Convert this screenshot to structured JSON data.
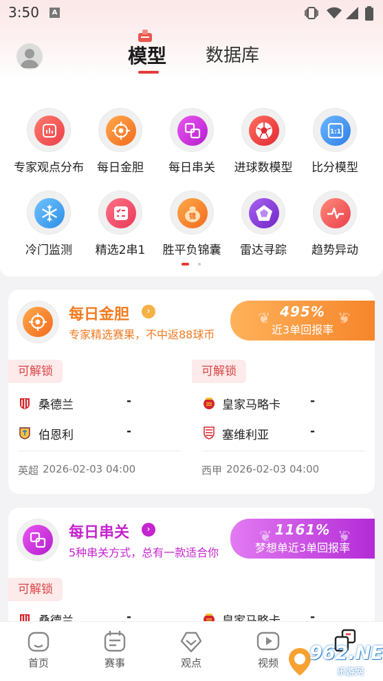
{
  "status_bar": {
    "time": "3:50",
    "notif_icon": "A"
  },
  "header": {
    "tabs": [
      {
        "label": "模型",
        "active": true
      },
      {
        "label": "数据库",
        "active": false
      }
    ],
    "accent": "#e63a3a"
  },
  "grid": [
    {
      "label": "专家观点分布",
      "icon": "bar-chart-icon",
      "color": "#ef5a5a"
    },
    {
      "label": "每日金胆",
      "icon": "target-icon",
      "color": "#f7892e"
    },
    {
      "label": "每日串关",
      "icon": "linked-squares-icon",
      "color": "#d12fd8"
    },
    {
      "label": "进球数模型",
      "icon": "soccer-ball-icon",
      "color": "#ee3b3b"
    },
    {
      "label": "比分模型",
      "icon": "scoreboard-icon",
      "color": "#3b8ff0"
    },
    {
      "label": "冷门监测",
      "icon": "snowflake-icon",
      "color": "#3aa5f2"
    },
    {
      "label": "精选2串1",
      "icon": "checklist-icon",
      "color": "#f04f66"
    },
    {
      "label": "胜平负锦囊",
      "icon": "money-bag-icon",
      "color": "#f7892e"
    },
    {
      "label": "雷达寻踪",
      "icon": "radar-pentagon-icon",
      "color": "#8b3fd8"
    },
    {
      "label": "趋势异动",
      "icon": "trend-pulse-icon",
      "color": "#ef4a4a"
    }
  ],
  "pager": {
    "pages": 2,
    "current": 1
  },
  "cards": [
    {
      "title": "每日金胆",
      "subtitle": "专家精选赛果，不中返88球币",
      "accent": "#f7892e",
      "return_value": "495%",
      "return_label": "近3单回报率",
      "matches": [
        {
          "unlock": "可解锁",
          "home": "桑德兰",
          "away": "伯恩利",
          "home_score": "-",
          "away_score": "-",
          "league": "英超",
          "time": "2026-02-03 04:00"
        },
        {
          "unlock": "可解锁",
          "home": "皇家马略卡",
          "away": "塞维利亚",
          "home_score": "-",
          "away_score": "-",
          "league": "西甲",
          "time": "2026-02-03 04:00"
        }
      ]
    },
    {
      "title": "每日串关",
      "subtitle": "5种串关方式，总有一款适合你",
      "accent": "#d12fd8",
      "return_value": "1161%",
      "return_label": "梦想单近3单回报率",
      "matches": [
        {
          "unlock": "可解锁",
          "home": "桑德兰",
          "home_score": "-"
        },
        {
          "unlock": "",
          "home": "皇家马略卡",
          "home_score": "-"
        }
      ]
    }
  ],
  "bottom_nav": [
    {
      "label": "首页",
      "icon": "home-icon"
    },
    {
      "label": "赛事",
      "icon": "calendar-icon"
    },
    {
      "label": "观点",
      "icon": "heart-badge-icon"
    },
    {
      "label": "视频",
      "icon": "video-icon"
    },
    {
      "label": "",
      "icon": "model-tab-icon"
    }
  ],
  "watermark": {
    "text": "962.NET",
    "sub": "乐游网"
  }
}
